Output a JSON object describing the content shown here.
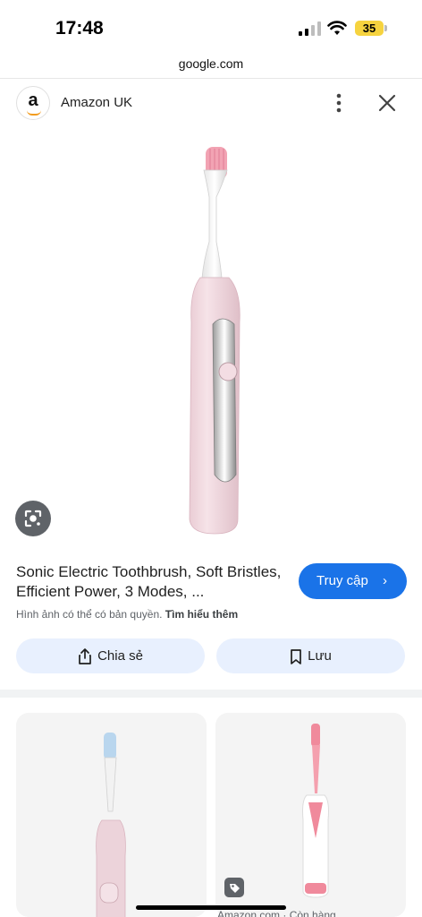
{
  "status": {
    "time": "17:48",
    "battery": "35"
  },
  "browser": {
    "url": "google.com"
  },
  "source": {
    "name": "Amazon UK",
    "logo_letter": "a"
  },
  "product": {
    "title": "Sonic Electric Toothbrush, Soft Bristles, Efficient Power, 3 Modes, ...",
    "visit_label": "Truy cập",
    "copyright_text": "Hình ảnh có thể có bản quyền.",
    "learn_more": "Tìm hiểu thêm"
  },
  "actions": {
    "share_label": "Chia sẻ",
    "save_label": "Lưu"
  },
  "related": {
    "caption": "Amazon.com · Còn hàng"
  },
  "colors": {
    "accent": "#1a73e8",
    "action_bg": "#e8f0fe",
    "battery": "#f6d33f"
  }
}
